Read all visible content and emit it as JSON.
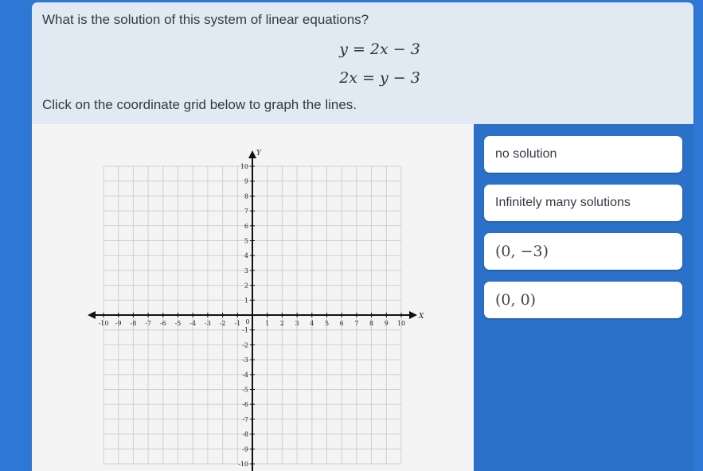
{
  "question": {
    "prompt": "What is the solution of this system of linear equations?",
    "equation1": "y = 2x − 3",
    "equation2": "2x = y − 3",
    "instruction": "Click on the coordinate grid below to graph the lines."
  },
  "graph": {
    "x_axis_label": "X",
    "y_axis_label": "Y",
    "x_range": [
      -10,
      10
    ],
    "y_range": [
      -10,
      10
    ],
    "x_tick_labels": [
      "-10",
      "-9",
      "-8",
      "-7",
      "-6",
      "-5",
      "-4",
      "-3",
      "-2",
      "-1",
      "1",
      "2",
      "3",
      "4",
      "5",
      "6",
      "7",
      "8",
      "9",
      "10"
    ],
    "y_tick_labels": [
      "10",
      "9",
      "8",
      "7",
      "6",
      "5",
      "4",
      "3",
      "2",
      "1",
      "-1",
      "-2",
      "-3",
      "-4",
      "-5",
      "-6",
      "-7",
      "-8",
      "-9",
      "-10"
    ]
  },
  "choices": [
    {
      "label": "no solution"
    },
    {
      "label": "Infinitely many solutions"
    },
    {
      "label": "(0, −3)"
    },
    {
      "label": "(0,  0)"
    }
  ],
  "colors": {
    "background": "#2f77d4",
    "question_panel": "#e1e9f3",
    "graph_panel": "#f4f4f4",
    "choice_card": "#ffffff"
  }
}
